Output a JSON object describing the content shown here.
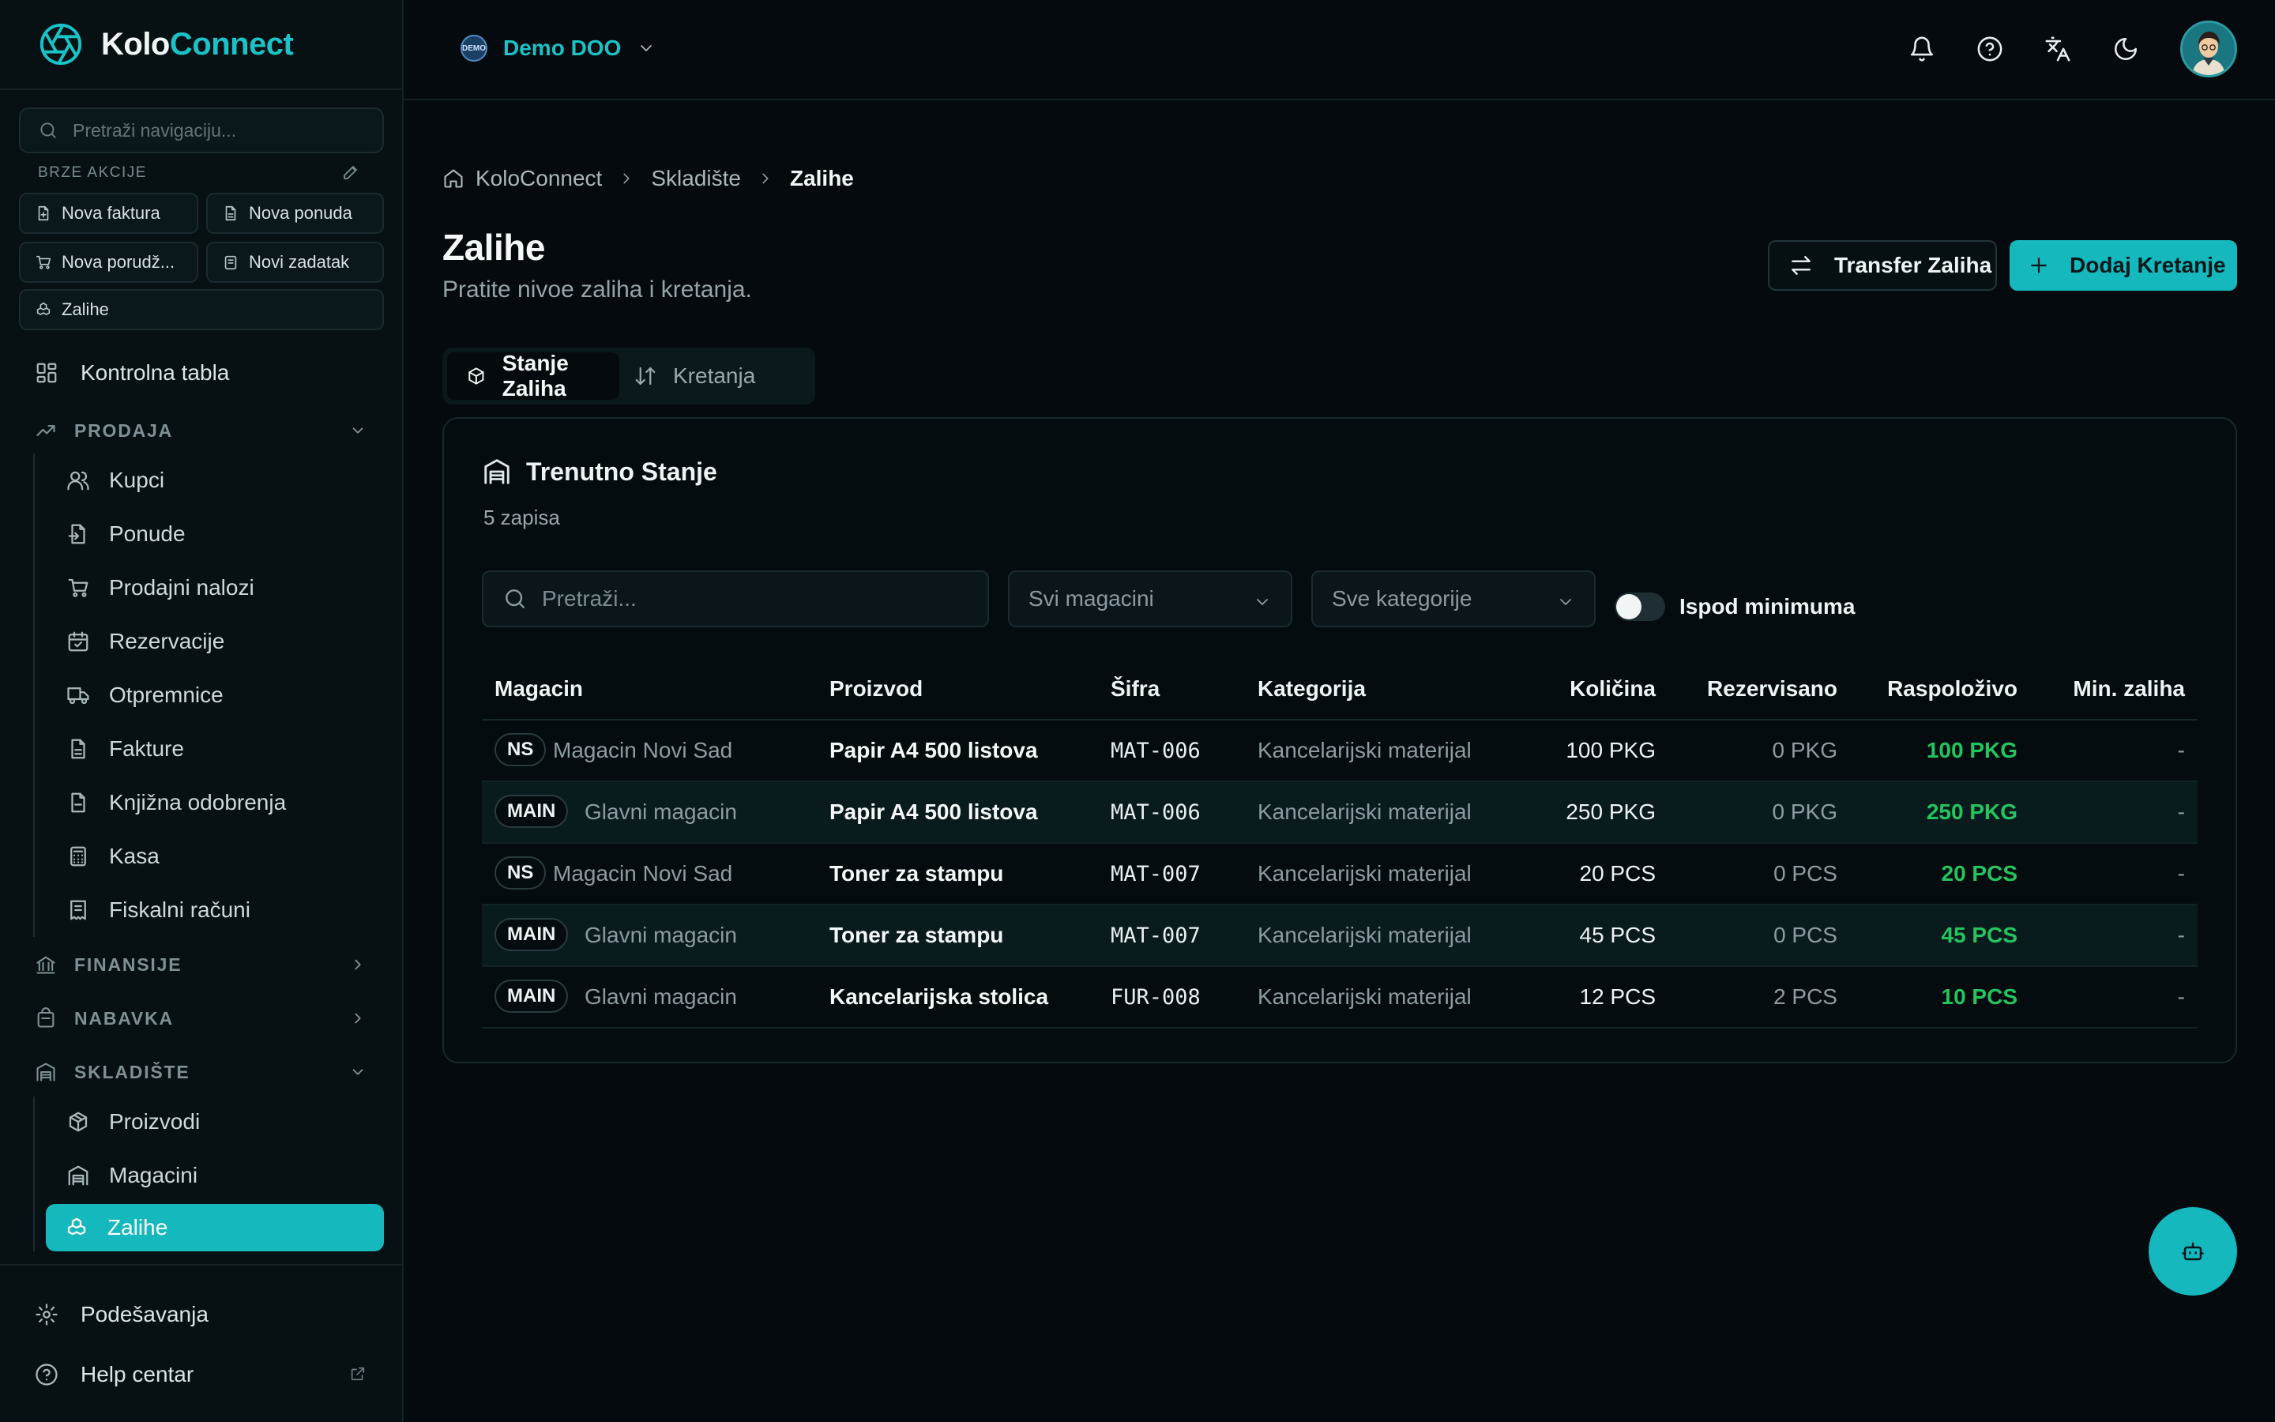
{
  "brand": {
    "name_part1": "Kolo",
    "name_part2": "Connect"
  },
  "sidebar": {
    "search_placeholder": "Pretraži navigaciju...",
    "quick_actions_title": "BRZE AKCIJE",
    "quick_actions": [
      {
        "label": "Nova faktura"
      },
      {
        "label": "Nova ponuda"
      },
      {
        "label": "Nova porudž..."
      },
      {
        "label": "Novi zadatak"
      },
      {
        "label": "Zalihe"
      }
    ],
    "dashboard": "Kontrolna tabla",
    "sections": {
      "prodaja": "PRODAJA",
      "finansije": "FINANSIJE",
      "nabavka": "NABAVKA",
      "skladiste": "SKLADIŠTE"
    },
    "prodaja_items": [
      "Kupci",
      "Ponude",
      "Prodajni nalozi",
      "Rezervacije",
      "Otpremnice",
      "Fakture",
      "Knjižna odobrenja",
      "Kasa",
      "Fiskalni računi"
    ],
    "skladiste_items": [
      "Proizvodi",
      "Magacini",
      "Zalihe"
    ],
    "settings": "Podešavanja",
    "help": "Help centar"
  },
  "topbar": {
    "company": "Demo DOO",
    "company_logo_text": "DEMO"
  },
  "breadcrumb": {
    "home": "KoloConnect",
    "section": "Skladište",
    "current": "Zalihe"
  },
  "page": {
    "title": "Zalihe",
    "subtitle": "Pratite nivoe zaliha i kretanja.",
    "transfer_button": "Transfer Zaliha",
    "add_button": "Dodaj Kretanje"
  },
  "tabs": {
    "stock": "Stanje Zaliha",
    "movements": "Kretanja"
  },
  "card": {
    "title": "Trenutno Stanje",
    "count": "5 zapisa",
    "search_placeholder": "Pretraži...",
    "warehouse_filter": "Svi magacini",
    "category_filter": "Sve kategorije",
    "below_min_label": "Ispod minimuma"
  },
  "table": {
    "headers": {
      "warehouse": "Magacin",
      "product": "Proizvod",
      "sku": "Šifra",
      "category": "Kategorija",
      "quantity": "Količina",
      "reserved": "Rezervisano",
      "available": "Raspoloživo",
      "min_stock": "Min. zaliha"
    },
    "rows": [
      {
        "code": "NS",
        "warehouse": "Magacin Novi Sad",
        "product": "Papir A4 500 listova",
        "sku": "MAT-006",
        "category": "Kancelarijski materijal",
        "quantity": "100 PKG",
        "reserved": "0 PKG",
        "available": "100 PKG",
        "min": "-"
      },
      {
        "code": "MAIN",
        "warehouse": "Glavni magacin",
        "product": "Papir A4 500 listova",
        "sku": "MAT-006",
        "category": "Kancelarijski materijal",
        "quantity": "250 PKG",
        "reserved": "0 PKG",
        "available": "250 PKG",
        "min": "-"
      },
      {
        "code": "NS",
        "warehouse": "Magacin Novi Sad",
        "product": "Toner za stampu",
        "sku": "MAT-007",
        "category": "Kancelarijski materijal",
        "quantity": "20 PCS",
        "reserved": "0 PCS",
        "available": "20 PCS",
        "min": "-"
      },
      {
        "code": "MAIN",
        "warehouse": "Glavni magacin",
        "product": "Toner za stampu",
        "sku": "MAT-007",
        "category": "Kancelarijski materijal",
        "quantity": "45 PCS",
        "reserved": "0 PCS",
        "available": "45 PCS",
        "min": "-"
      },
      {
        "code": "MAIN",
        "warehouse": "Glavni magacin",
        "product": "Kancelarijska stolica",
        "sku": "FUR-008",
        "category": "Kancelarijski materijal",
        "quantity": "12 PCS",
        "reserved": "2 PCS",
        "available": "10 PCS",
        "min": "-"
      }
    ]
  },
  "colors": {
    "accent": "#14b8bd",
    "available_green": "#22c55e",
    "background": "#040a0d",
    "sidebar": "#071114"
  }
}
